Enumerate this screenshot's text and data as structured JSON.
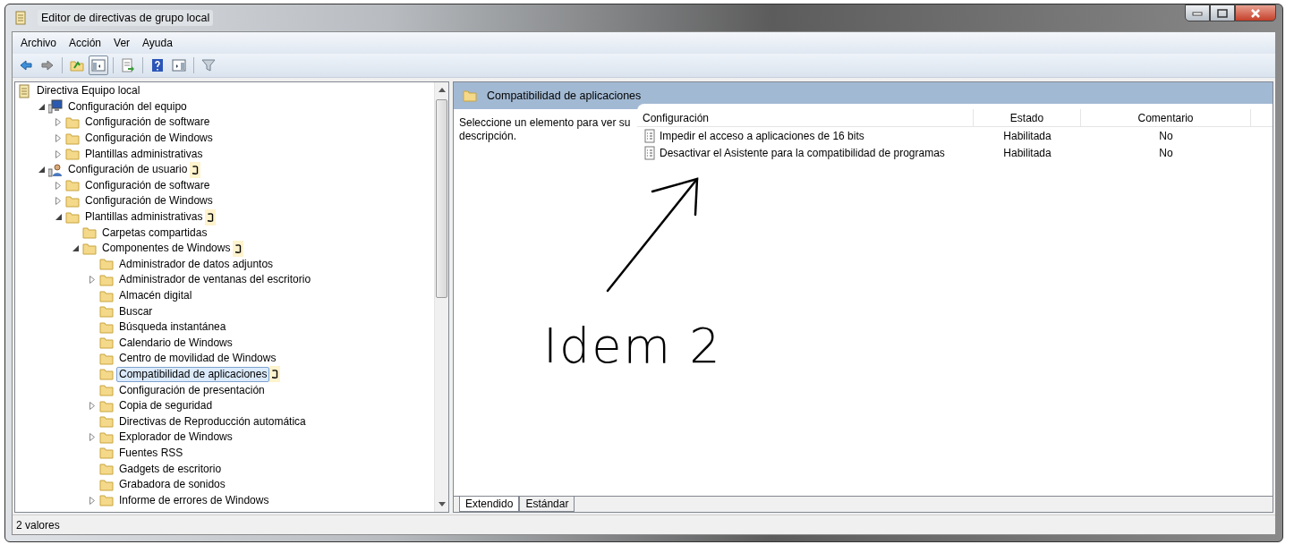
{
  "window": {
    "title": "Editor de directivas de grupo local"
  },
  "menu": [
    "Archivo",
    "Acción",
    "Ver",
    "Ayuda"
  ],
  "toolbar": [
    {
      "kind": "back",
      "pressed": false
    },
    {
      "kind": "forward",
      "pressed": false
    },
    {
      "kind": "sep"
    },
    {
      "kind": "up",
      "pressed": false
    },
    {
      "kind": "tree",
      "pressed": true
    },
    {
      "kind": "sep"
    },
    {
      "kind": "export",
      "pressed": false
    },
    {
      "kind": "sep"
    },
    {
      "kind": "help",
      "pressed": false
    },
    {
      "kind": "pane",
      "pressed": false
    },
    {
      "kind": "sep"
    },
    {
      "kind": "filter",
      "pressed": false
    }
  ],
  "tree": [
    {
      "label": "Directiva Equipo local",
      "kind": "policy",
      "selected": false,
      "children": [
        {
          "label": "Configuración del equipo",
          "kind": "computer",
          "expanded": true,
          "selected": false,
          "children": [
            {
              "label": "Configuración de software",
              "expanded": false,
              "selected": false
            },
            {
              "label": "Configuración de Windows",
              "expanded": false,
              "selected": false
            },
            {
              "label": "Plantillas administrativas",
              "expanded": false,
              "selected": false
            }
          ]
        },
        {
          "label": "Configuración de usuario",
          "kind": "user",
          "expanded": true,
          "selected": false,
          "marked": true,
          "children": [
            {
              "label": "Configuración de software",
              "expanded": false,
              "selected": false
            },
            {
              "label": "Configuración de Windows",
              "expanded": false,
              "selected": false
            },
            {
              "label": "Plantillas administrativas",
              "expanded": true,
              "selected": false,
              "marked": true,
              "children": [
                {
                  "label": "Carpetas compartidas",
                  "selected": false
                },
                {
                  "label": "Componentes de Windows",
                  "expanded": true,
                  "selected": false,
                  "marked": true,
                  "children": [
                    {
                      "label": "Administrador de datos adjuntos",
                      "selected": false
                    },
                    {
                      "label": "Administrador de ventanas del escritorio",
                      "expanded": false,
                      "selected": false
                    },
                    {
                      "label": "Almacén digital",
                      "selected": false
                    },
                    {
                      "label": "Buscar",
                      "selected": false
                    },
                    {
                      "label": "Búsqueda instantánea",
                      "selected": false
                    },
                    {
                      "label": "Calendario de Windows",
                      "selected": false
                    },
                    {
                      "label": "Centro de movilidad de Windows",
                      "selected": false
                    },
                    {
                      "label": "Compatibilidad de aplicaciones",
                      "selected": true,
                      "marked": true
                    },
                    {
                      "label": "Configuración de presentación",
                      "selected": false
                    },
                    {
                      "label": "Copia de seguridad",
                      "expanded": false,
                      "selected": false
                    },
                    {
                      "label": "Directivas de Reproducción automática",
                      "selected": false
                    },
                    {
                      "label": "Explorador de Windows",
                      "expanded": false,
                      "selected": false
                    },
                    {
                      "label": "Fuentes RSS",
                      "selected": false
                    },
                    {
                      "label": "Gadgets de escritorio",
                      "selected": false
                    },
                    {
                      "label": "Grabadora de sonidos",
                      "selected": false
                    },
                    {
                      "label": "Informe de errores de Windows",
                      "expanded": false,
                      "selected": false
                    }
                  ]
                }
              ]
            }
          ]
        }
      ]
    }
  ],
  "detail": {
    "title": "Compatibilidad de aplicaciones",
    "description": "Seleccione un elemento para ver su descripción.",
    "columns": [
      "Configuración",
      "Estado",
      "Comentario"
    ],
    "rows": [
      {
        "setting": "Impedir el acceso a aplicaciones de 16 bits",
        "state": "Habilitada",
        "comment": "No"
      },
      {
        "setting": "Desactivar el Asistente para la compatibilidad de programas",
        "state": "Habilitada",
        "comment": "No"
      }
    ],
    "tabs": [
      {
        "label": "Extendido",
        "selected": true
      },
      {
        "label": "Estándar",
        "selected": false
      }
    ]
  },
  "annotation": {
    "text": "Idem 2"
  },
  "status_bar": "2 valores"
}
